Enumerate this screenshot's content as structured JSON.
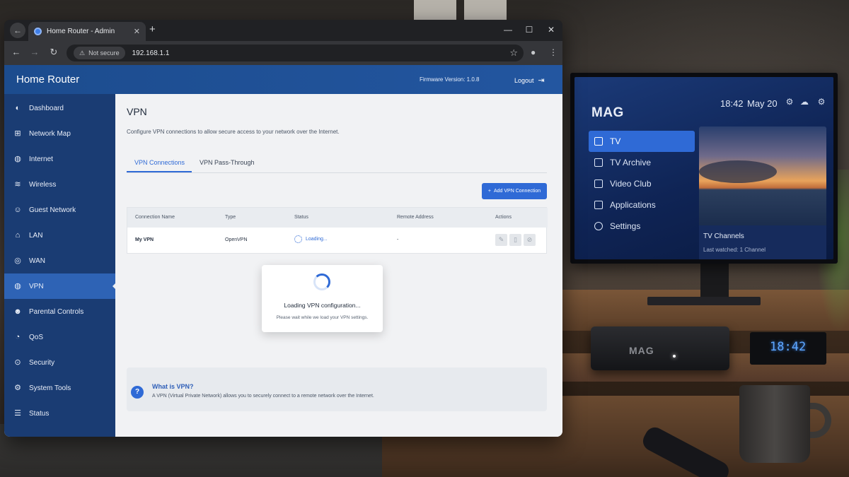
{
  "browser": {
    "tab_title": "Home Router - Admin",
    "security_label": "Not secure",
    "url": "192.168.1.1"
  },
  "router": {
    "brand": "Home Router",
    "firmware": "Firmware Version: 1.0.8",
    "logout": "Logout",
    "sidebar": [
      {
        "label": "Dashboard",
        "icon": "dashboard-icon"
      },
      {
        "label": "Network Map",
        "icon": "network-map-icon"
      },
      {
        "label": "Internet",
        "icon": "globe-icon"
      },
      {
        "label": "Wireless",
        "icon": "wifi-icon"
      },
      {
        "label": "Guest Network",
        "icon": "guest-icon"
      },
      {
        "label": "LAN",
        "icon": "lan-icon"
      },
      {
        "label": "WAN",
        "icon": "wan-icon"
      },
      {
        "label": "VPN",
        "icon": "shield-icon",
        "active": true
      },
      {
        "label": "Parental Controls",
        "icon": "parental-icon"
      },
      {
        "label": "QoS",
        "icon": "qos-icon"
      },
      {
        "label": "Security",
        "icon": "security-icon"
      },
      {
        "label": "System Tools",
        "icon": "gear-icon"
      },
      {
        "label": "Status",
        "icon": "status-icon"
      }
    ],
    "page": {
      "title": "VPN",
      "description": "Configure VPN connections to allow secure access to your network over the Internet.",
      "tabs": [
        "VPN Connections",
        "VPN Pass-Through"
      ],
      "add_button": "Add VPN Connection",
      "table": {
        "headers": [
          "Connection Name",
          "Type",
          "Status",
          "Remote Address",
          "Actions"
        ],
        "rows": [
          {
            "name": "My VPN",
            "type": "OpenVPN",
            "status": "Loading...",
            "remote": "-"
          }
        ]
      },
      "modal": {
        "title": "Loading VPN configuration...",
        "subtitle": "Please wait while we load your VPN settings."
      },
      "info": {
        "title": "What is VPN?",
        "text": "A VPN (Virtual Private Network) allows you to securely connect to a remote network over the Internet."
      }
    },
    "accent_color": "#2f6ad6",
    "header_color": "#1c4c8e",
    "sidebar_color": "#1a3c73"
  },
  "tv": {
    "logo": "MAG",
    "time": "18:42",
    "date": "May 20",
    "menu": [
      {
        "label": "TV",
        "active": true
      },
      {
        "label": "TV Archive"
      },
      {
        "label": "Video Club"
      },
      {
        "label": "Applications"
      },
      {
        "label": "Settings"
      }
    ],
    "channels_title": "TV Channels",
    "channels_sub": "Last watched: 1 Channel"
  },
  "settop_box": {
    "label": "MAG",
    "clock": "18:42"
  }
}
